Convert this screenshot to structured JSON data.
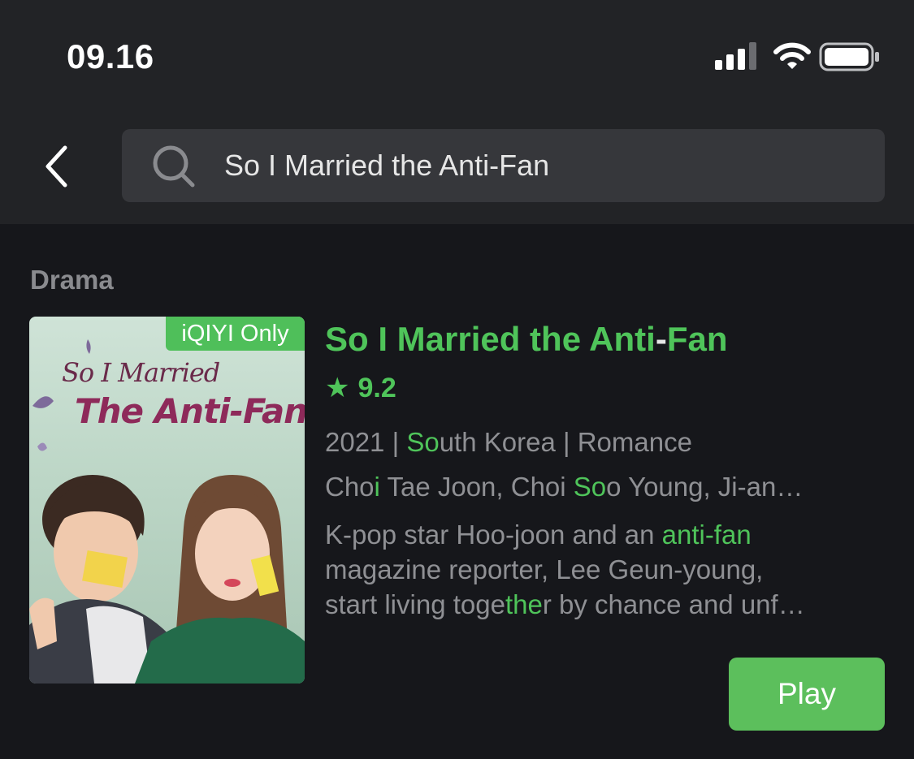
{
  "status_bar": {
    "time": "09.16",
    "icons": [
      "signal-icon",
      "wifi-icon",
      "battery-icon"
    ]
  },
  "header": {
    "back_icon": "chevron-left-icon",
    "search": {
      "icon": "search-icon",
      "value": "So I Married the Anti-Fan"
    }
  },
  "section": {
    "label": "Drama"
  },
  "result": {
    "badge": "iQIYI Only",
    "poster_text_line1": "So I Married",
    "poster_text_line2": "The Anti-Fan",
    "title_a": "So I Married the Anti",
    "title_dash": "-",
    "title_b": "Fan",
    "rating": "9.2",
    "meta_a": "2021 | ",
    "meta_hl": "So",
    "meta_b": "uth Korea | Romance",
    "cast_a": "Cho",
    "cast_hl1": "i",
    "cast_b": " Tae Joon, Choi ",
    "cast_hl2": "So",
    "cast_c": "o Young, Ji-an…",
    "desc1_a": "K-pop star Hoo-joon and an ",
    "desc1_hl": "anti-fan",
    "desc2": "magazine reporter, Lee Geun-young,",
    "desc3_a": "start living toge",
    "desc3_hl": "the",
    "desc3_b": "r by chance and unf…",
    "play_label": "Play"
  },
  "colors": {
    "background": "#16171b",
    "header": "#222326",
    "accent": "#4fc45a",
    "muted_text": "#8f9094",
    "search_field": "#36373b"
  }
}
